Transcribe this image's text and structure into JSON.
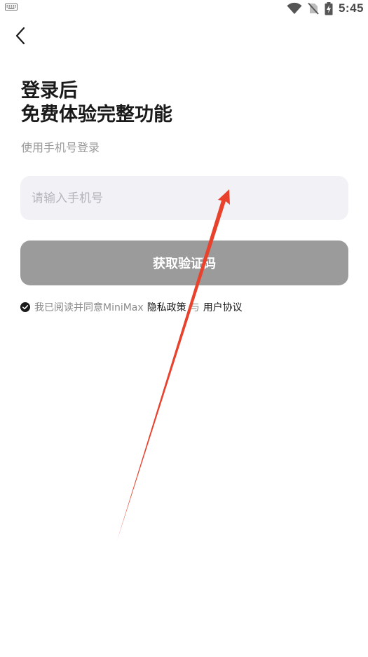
{
  "status_bar": {
    "time": "5:45",
    "icons": [
      "keyboard-icon",
      "wifi-icon",
      "no-sim-icon",
      "battery-charging-icon"
    ]
  },
  "nav": {
    "back_icon": "chevron-left-icon"
  },
  "title": {
    "line1": "登录后",
    "line2": "免费体验完整功能"
  },
  "subtitle": "使用手机号登录",
  "phone_input": {
    "placeholder": "请输入手机号",
    "value": ""
  },
  "get_code_button": "获取验证码",
  "agreement": {
    "checked": true,
    "prefix": "我已阅读并同意MiniMax",
    "privacy_link": "隐私政策",
    "separator": "与",
    "terms_link": "用户协议"
  },
  "colors": {
    "button_disabled": "#9b9b9b",
    "input_bg": "#f1f1f6",
    "annotation_arrow": "#e8412c"
  }
}
